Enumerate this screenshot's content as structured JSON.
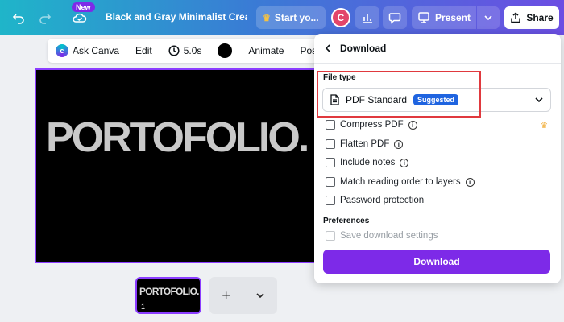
{
  "topbar": {
    "new_badge": "New",
    "doc_title": "Black and Gray Minimalist Creat...",
    "start_label": "Start yo...",
    "avatar_initial": "C",
    "present_label": "Present",
    "share_label": "Share"
  },
  "toolbar": {
    "ask_canva": "Ask Canva",
    "edit": "Edit",
    "duration": "5.0s",
    "animate": "Animate",
    "position": "Posi"
  },
  "canvas": {
    "title": "PORTOFOLIO."
  },
  "pages": {
    "thumb_title": "PORTOFOLIO.",
    "thumb_number": "1",
    "add_symbol": "+"
  },
  "download_panel": {
    "title": "Download",
    "file_type_label": "File type",
    "file_type_value": "PDF Standard",
    "suggested_badge": "Suggested",
    "options": {
      "compress": "Compress PDF",
      "flatten": "Flatten PDF",
      "notes": "Include notes",
      "reading_order": "Match reading order to layers",
      "password": "Password protection"
    },
    "preferences_label": "Preferences",
    "save_settings": "Save download settings",
    "download_button": "Download"
  },
  "colors": {
    "accent": "#7d2ae8",
    "highlight": "#e0393e",
    "suggested": "#1f64e0"
  }
}
